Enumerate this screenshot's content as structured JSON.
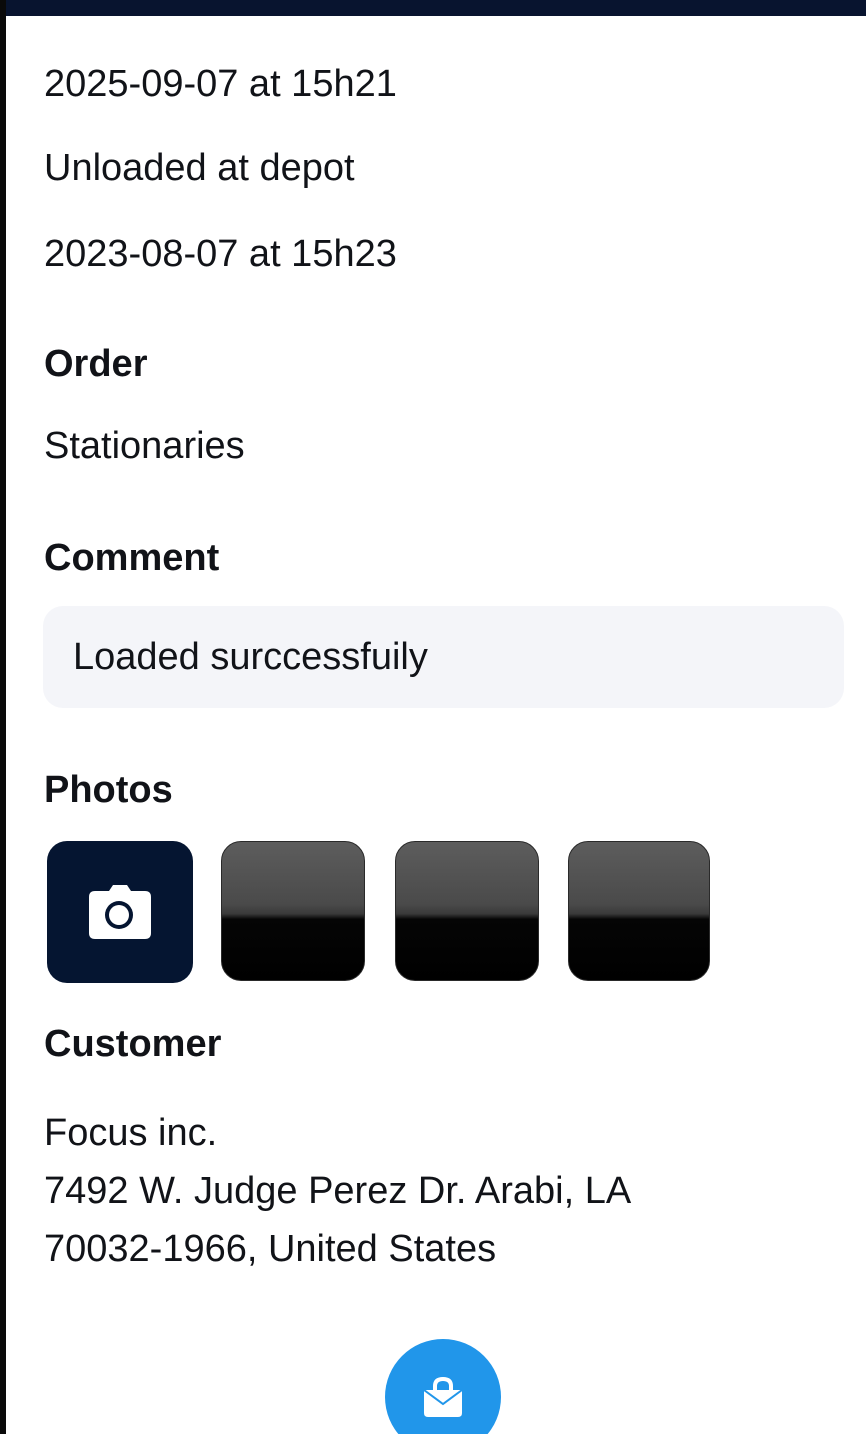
{
  "timeline": {
    "first_timestamp": "2025-09-07 at 15h21",
    "status": "Unloaded at depot",
    "second_timestamp": "2023-08-07 at 15h23"
  },
  "order": {
    "heading": "Order",
    "value": "Stationaries"
  },
  "comment": {
    "heading": "Comment",
    "value": "Loaded surccessfuily"
  },
  "photos": {
    "heading": "Photos",
    "add_icon": "camera-icon",
    "thumbnail_count": 3
  },
  "customer": {
    "heading": "Customer",
    "name": "Focus inc.",
    "address_line1": "7492 W. Judge Perez Dr. Arabi, LA",
    "address_line2": "70032-1966, United States"
  },
  "fab": {
    "icon": "shopping-bag-icon",
    "color": "#2196ea"
  },
  "colors": {
    "navy": "#051531",
    "comment_bg": "#f4f5f9"
  }
}
